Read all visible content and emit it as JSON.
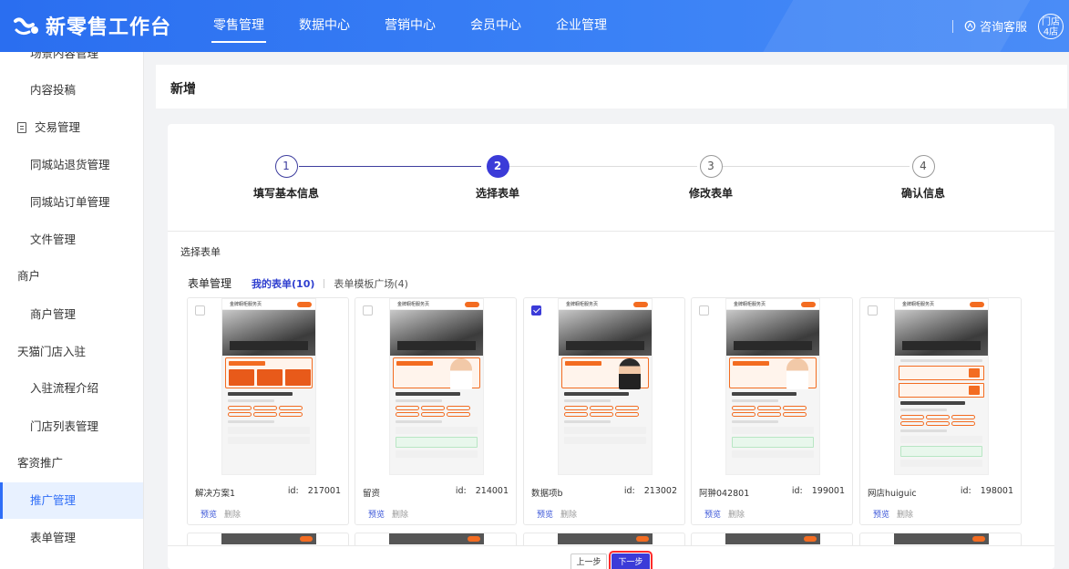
{
  "app": {
    "logo_text": "新零售工作台"
  },
  "nav": {
    "items": [
      {
        "label": "零售管理",
        "active": true
      },
      {
        "label": "数据中心"
      },
      {
        "label": "营销中心"
      },
      {
        "label": "会员中心"
      },
      {
        "label": "企业管理"
      }
    ],
    "support_label": "咨询客服",
    "avatar_line1": "门店",
    "avatar_line2": "4店"
  },
  "sidebar": {
    "items": [
      {
        "label": "场景内容管理",
        "type": "sub"
      },
      {
        "label": "内容投稿",
        "type": "sub"
      },
      {
        "label": "交易管理",
        "type": "group",
        "icon": "document-icon"
      },
      {
        "label": "同城站退货管理",
        "type": "sub"
      },
      {
        "label": "同城站订单管理",
        "type": "sub"
      },
      {
        "label": "文件管理",
        "type": "sub"
      },
      {
        "label": "商户",
        "type": "group"
      },
      {
        "label": "商户管理",
        "type": "sub"
      },
      {
        "label": "天猫门店入驻",
        "type": "group"
      },
      {
        "label": "入驻流程介绍",
        "type": "sub"
      },
      {
        "label": "门店列表管理",
        "type": "sub"
      },
      {
        "label": "客资推广",
        "type": "group"
      },
      {
        "label": "推广管理",
        "type": "sub",
        "active": true
      },
      {
        "label": "表单管理",
        "type": "sub"
      }
    ]
  },
  "page": {
    "title": "新增"
  },
  "steps": [
    {
      "number": "1",
      "label": "填写基本信息",
      "state": "done"
    },
    {
      "number": "2",
      "label": "选择表单",
      "state": "active"
    },
    {
      "number": "3",
      "label": "修改表单",
      "state": "todo"
    },
    {
      "number": "4",
      "label": "确认信息",
      "state": "todo"
    }
  ],
  "form_select": {
    "section_title": "选择表单",
    "tab_heading": "表单管理",
    "tabs": [
      {
        "label": "我的表单(10)",
        "active": true
      },
      {
        "label": "表单模板广场(4)"
      }
    ],
    "id_label": "id:",
    "preview_label": "预览",
    "delete_label": "删除",
    "thumb_header": "金牌橱柜服务页",
    "cards": [
      {
        "name": "解决方案1",
        "id": "217001",
        "checked": false,
        "variant": "solution"
      },
      {
        "name": "留资",
        "id": "214001",
        "checked": false,
        "variant": "consult"
      },
      {
        "name": "数据项b",
        "id": "213002",
        "checked": true,
        "variant": "expert"
      },
      {
        "name": "阿翀042801",
        "id": "199001",
        "checked": false,
        "variant": "consult"
      },
      {
        "name": "网店huiguic",
        "id": "198001",
        "checked": false,
        "variant": "gift"
      }
    ]
  },
  "footer": {
    "prev_label": "上一步",
    "next_label": "下一步"
  },
  "colors": {
    "brand": "#2f6ef7",
    "step_active": "#3b3bd8",
    "accent_orange": "#f36c21",
    "highlight": "#ff2a2a"
  }
}
